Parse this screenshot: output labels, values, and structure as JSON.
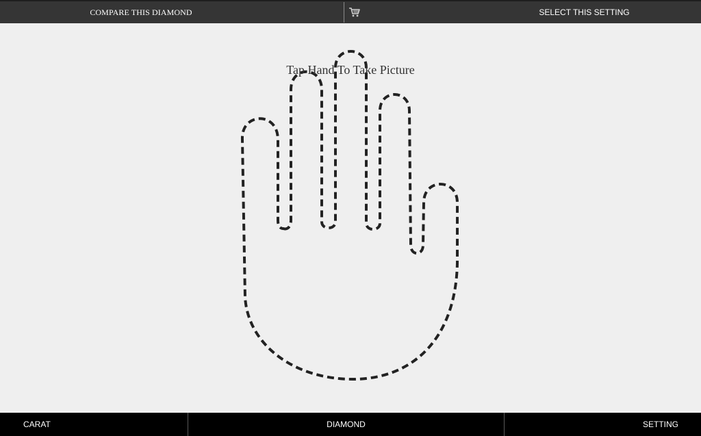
{
  "top_bar": {
    "compare_label": "COMPARE THIS DIAMOND",
    "cart_icon": "shopping-cart-icon",
    "select_label": "SELECT THIS SETTING"
  },
  "main": {
    "instruction": "Tap Hand To Take Picture",
    "hand_icon": "hand-outline-icon"
  },
  "bottom_nav": {
    "items": [
      {
        "label": "CARAT"
      },
      {
        "label": "DIAMOND"
      },
      {
        "label": "SETTING"
      }
    ]
  },
  "colors": {
    "top_bar_bg": "#353535",
    "bottom_bar_bg": "#000000",
    "page_bg": "#efefef",
    "hand_stroke": "#222222"
  }
}
